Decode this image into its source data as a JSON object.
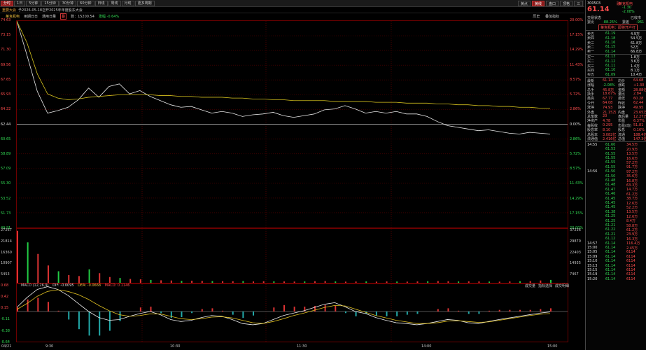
{
  "toolbar": {
    "tabs": [
      "分时",
      "1日",
      "5分钟",
      "15分钟",
      "30分钟",
      "60分钟",
      "日线",
      "周线",
      "月线",
      "更多周期"
    ],
    "right": [
      "黄点",
      "黄线",
      "盘口",
      "顶格",
      "三"
    ]
  },
  "infobar": {
    "tag": "重要大会",
    "text": "予2026-05-18召开2025年年度股东大会"
  },
  "legend": {
    "name": "莱克机电",
    "a": "用期日日",
    "b": "通用日量",
    "c": "数：15200.54",
    "d": "涨幅 -0.64%",
    "right1": "历史",
    "right2": "叠加指标"
  },
  "price_axis": {
    "left": [
      "74.63",
      "73.15",
      "71.30",
      "69.56",
      "67.65",
      "65.93",
      "64.22",
      "62.44",
      "60.65",
      "58.89",
      "57.09",
      "55.30",
      "53.52",
      "51.73",
      "49.91"
    ],
    "right": [
      "20.00%",
      "17.15%",
      "14.29%",
      "11.43%",
      "8.57%",
      "5.72%",
      "2.86%",
      "0.00%",
      "2.86%",
      "5.72%",
      "8.57%",
      "11.43%",
      "14.29%",
      "17.15%",
      "20.00%"
    ]
  },
  "vol_axis": {
    "left": [
      "27267",
      "21814",
      "16360",
      "10907",
      "5453"
    ],
    "right": [
      "37236",
      "29870",
      "22403",
      "14935",
      "7467"
    ]
  },
  "macd_axis": {
    "left": [
      "0.68",
      "0.42",
      "0.15",
      "-0.11",
      "-0.38",
      "-0.64"
    ]
  },
  "macd_legend": {
    "a": "MACD (12,26,9)",
    "dif": "DIF: -0.0095",
    "dea": "DEA: -0.0668",
    "macd": "MACD: 0.1146"
  },
  "vol_tabs": [
    "成交量",
    "指标选择",
    "成交明细"
  ],
  "time_axis": [
    "04/21",
    "9:30",
    "10:30",
    "11:30",
    "14:00",
    "15:00"
  ],
  "chart_data": {
    "type": "line",
    "x_ticks": [
      "9:30",
      "10:30",
      "11:30",
      "14:00",
      "15:00"
    ],
    "prev_close": 62.44,
    "ylim": [
      49.91,
      74.63
    ],
    "series": [
      {
        "values": [
          74.63,
          70.5,
          66.2,
          63.6,
          63.9,
          64.3,
          65.2,
          66.6,
          65.5,
          66.8,
          67.1,
          65.9,
          66.3,
          65.6,
          65.1,
          64.6,
          64.3,
          64.4,
          64.0,
          63.6,
          63.8,
          63.6,
          63.2,
          63.4,
          63.5,
          63.7,
          63.3,
          63.1,
          63.3,
          63.5,
          64.0,
          64.1,
          64.5,
          64.1,
          63.6,
          63.8,
          63.6,
          63.8,
          63.5,
          63.5,
          63.2,
          62.6,
          62.1,
          61.9,
          61.7,
          61.5,
          61.6,
          61.4,
          61.2,
          61.1,
          61.3,
          61.2,
          61.1
        ]
      },
      {
        "values": [
          74.63,
          72.0,
          68.3,
          65.9,
          65.4,
          65.2,
          65.3,
          65.5,
          65.6,
          65.7,
          65.8,
          65.8,
          65.8,
          65.8,
          65.7,
          65.7,
          65.6,
          65.6,
          65.5,
          65.5,
          65.5,
          65.4,
          65.4,
          65.3,
          65.3,
          65.2,
          65.2,
          65.1,
          65.1,
          65.1,
          65.1,
          65.0,
          65.0,
          65.0,
          65.0,
          64.9,
          64.9,
          64.9,
          64.8,
          64.8,
          64.8,
          64.7,
          64.7,
          64.6,
          64.6,
          64.5,
          64.5,
          64.4,
          64.4,
          64.3,
          64.3,
          64.2,
          64.2
        ]
      }
    ],
    "volume": [
      27000,
      21000,
      15000,
      9000,
      6000,
      4000,
      3500,
      7000,
      5000,
      3000,
      2500,
      2000,
      1800,
      1500,
      1300,
      1200,
      1000,
      1100,
      1000,
      900,
      850,
      800,
      900,
      700,
      800,
      750,
      700,
      650,
      700,
      800,
      900,
      700,
      600,
      650,
      700,
      600,
      700,
      650,
      600,
      700,
      800,
      900,
      800,
      700,
      750,
      700,
      650,
      600,
      700,
      800,
      900,
      1200,
      1500
    ],
    "macd": {
      "dif": [
        0.1,
        0.35,
        0.55,
        0.62,
        0.55,
        0.4,
        0.2,
        0.0,
        -0.15,
        -0.22,
        -0.2,
        -0.12,
        -0.05,
        0.0,
        -0.08,
        -0.2,
        -0.25,
        -0.22,
        -0.15,
        -0.1,
        -0.12,
        -0.2,
        -0.3,
        -0.33,
        -0.3,
        -0.2,
        -0.1,
        -0.04,
        0.02,
        0.1,
        0.18,
        0.22,
        0.12,
        0.0,
        -0.05,
        -0.15,
        -0.22,
        -0.28,
        -0.3,
        -0.33,
        -0.3,
        -0.25,
        -0.2,
        -0.22,
        -0.28,
        -0.3,
        -0.25,
        -0.2,
        -0.16,
        -0.12,
        -0.08,
        -0.04,
        -0.01
      ],
      "dea": [
        0.05,
        0.2,
        0.38,
        0.5,
        0.54,
        0.5,
        0.42,
        0.3,
        0.15,
        0.02,
        -0.08,
        -0.12,
        -0.1,
        -0.06,
        -0.06,
        -0.12,
        -0.18,
        -0.2,
        -0.18,
        -0.14,
        -0.13,
        -0.16,
        -0.22,
        -0.28,
        -0.3,
        -0.25,
        -0.18,
        -0.1,
        -0.04,
        0.03,
        0.1,
        0.15,
        0.14,
        0.06,
        -0.02,
        -0.1,
        -0.16,
        -0.22,
        -0.26,
        -0.3,
        -0.3,
        -0.28,
        -0.24,
        -0.23,
        -0.25,
        -0.27,
        -0.26,
        -0.22,
        -0.18,
        -0.14,
        -0.1,
        -0.07,
        -0.05
      ],
      "hist": [
        0.1,
        0.3,
        0.34,
        0.24,
        0.02,
        -0.2,
        -0.44,
        -0.6,
        -0.6,
        -0.48,
        -0.24,
        0.0,
        0.1,
        0.12,
        -0.04,
        -0.16,
        -0.14,
        -0.04,
        0.06,
        0.08,
        0.02,
        -0.08,
        -0.16,
        -0.1,
        0.0,
        0.1,
        0.16,
        0.12,
        0.12,
        0.14,
        0.16,
        0.14,
        -0.04,
        -0.12,
        -0.06,
        -0.1,
        -0.12,
        -0.12,
        -0.08,
        -0.06,
        0.0,
        0.06,
        0.08,
        0.02,
        -0.06,
        -0.06,
        0.02,
        0.04,
        0.04,
        0.04,
        0.04,
        0.06,
        0.08
      ]
    }
  },
  "quote": {
    "code": "300503",
    "name": "莱克机电",
    "price": "61.14",
    "change": "-1.30",
    "pct": "-2.08%",
    "market": "融",
    "status": "交易状态",
    "status_v": "已收市",
    "wb_l": "委比",
    "wb": "-88.25%",
    "wc_l": "委差",
    "wc": "-961",
    "promo": "莱克机电：即将开户打",
    "asks": [
      [
        "卖五",
        "61.19",
        "4.9万"
      ],
      [
        "卖四",
        "61.18",
        "54.5万"
      ],
      [
        "卖三",
        "61.16",
        "61.8万"
      ],
      [
        "卖二",
        "61.15",
        "52万"
      ],
      [
        "卖一",
        "61.14",
        "66.8万"
      ]
    ],
    "bids": [
      [
        "买一",
        "61.13",
        "1.8万"
      ],
      [
        "买二",
        "61.12",
        "3.6万"
      ],
      [
        "买三",
        "61.11",
        "1.4万"
      ],
      [
        "买四",
        "61.10",
        "8.1万"
      ],
      [
        "买五",
        "61.09",
        "10.4万"
      ]
    ],
    "stats": [
      [
        "最新",
        "61.14",
        "均价",
        "64.68"
      ],
      [
        "涨幅",
        "-2.08%",
        "涨跌",
        "+1.30"
      ],
      [
        "总手",
        "45.8万",
        "金额",
        "28.88亿"
      ],
      [
        "换手",
        "18.67%",
        "量比",
        "2.84"
      ],
      [
        "最高",
        "67.77",
        "最低",
        "60.28"
      ],
      [
        "今开",
        "64.08",
        "昨收",
        "62.44"
      ],
      [
        "涨停",
        "74.93",
        "跌停",
        "49.95"
      ],
      [
        "外盘",
        "21.15万",
        "内盘",
        "23.65万"
      ],
      [
        "总笔数",
        "20",
        "盘后量",
        "12.27万"
      ],
      [
        "净资产",
        "4.78",
        "市盈",
        "6.37%"
      ],
      [
        "每股收",
        "0.295",
        "市盈(动)",
        "51.81"
      ],
      [
        "股息率",
        "8.10",
        "股息",
        "0.16%"
      ],
      [
        "总股本",
        "3.082亿",
        "流通",
        "188.4亿"
      ],
      [
        "流通值",
        "2.416亿",
        "总值",
        "147.3亿"
      ]
    ],
    "ticks": [
      [
        "14:55",
        "61.60",
        "34.5万"
      ],
      [
        "",
        "61.53",
        "20.9万"
      ],
      [
        "",
        "61.55",
        "13.5万"
      ],
      [
        "",
        "61.55",
        "16.6万"
      ],
      [
        "",
        "61.55",
        "57.2万"
      ],
      [
        "",
        "61.55",
        "91.7万"
      ],
      [
        "14:56",
        "61.50",
        "97.2万"
      ],
      [
        "",
        "61.50",
        "35.6万"
      ],
      [
        "",
        "61.48",
        "16.8万"
      ],
      [
        "",
        "61.48",
        "63.3万"
      ],
      [
        "",
        "61.47",
        "14.7万"
      ],
      [
        "",
        "61.46",
        "61.2万"
      ],
      [
        "",
        "61.45",
        "38.7万"
      ],
      [
        "",
        "61.45",
        "12.6万"
      ],
      [
        "",
        "61.45",
        "52.2万"
      ],
      [
        "",
        "61.38",
        "13.5万"
      ],
      [
        "",
        "61.25",
        "12.6万"
      ],
      [
        "",
        "61.25",
        "8.4万"
      ],
      [
        "",
        "61.21",
        "58.8万"
      ],
      [
        "",
        "61.22",
        "61.2万"
      ],
      [
        "",
        "61.21",
        "23.9万"
      ],
      [
        "",
        "61.12",
        "16.3万"
      ],
      [
        "14:57",
        "61.14",
        "116.4万"
      ],
      [
        "15:00",
        "61.14",
        "2.45万"
      ],
      [
        "15:05",
        "61.14",
        "6114"
      ],
      [
        "15:09",
        "61.14",
        "6114"
      ],
      [
        "15:10",
        "61.14",
        "6114"
      ],
      [
        "15:13",
        "61.14",
        "6114"
      ],
      [
        "15:15",
        "61.14",
        "6114"
      ],
      [
        "15:19",
        "61.14",
        "6114"
      ],
      [
        "15:20",
        "61.14",
        "6114"
      ]
    ]
  }
}
